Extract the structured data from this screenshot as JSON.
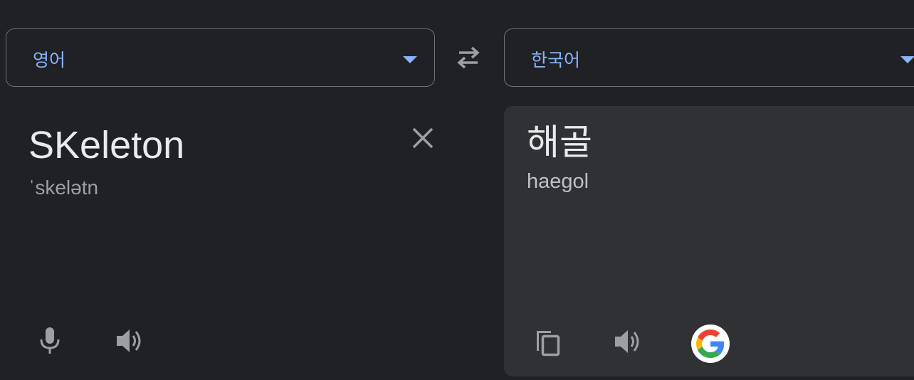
{
  "source_language": {
    "label": "영어"
  },
  "target_language": {
    "label": "한국어"
  },
  "source": {
    "text": "SKeleton",
    "phonetic": "ˈskelətn"
  },
  "translation": {
    "text": "해골",
    "romanization": "haegol"
  },
  "icons": {
    "swap": "swap-arrows-icon",
    "clear": "close-icon",
    "mic": "microphone-icon",
    "speaker": "speaker-icon",
    "copy": "copy-icon",
    "google": "google-logo-icon"
  },
  "colors": {
    "background": "#202124",
    "panel": "#303134",
    "accent": "#8ab4f8",
    "text": "#e8eaed",
    "muted": "#9aa0a6"
  }
}
